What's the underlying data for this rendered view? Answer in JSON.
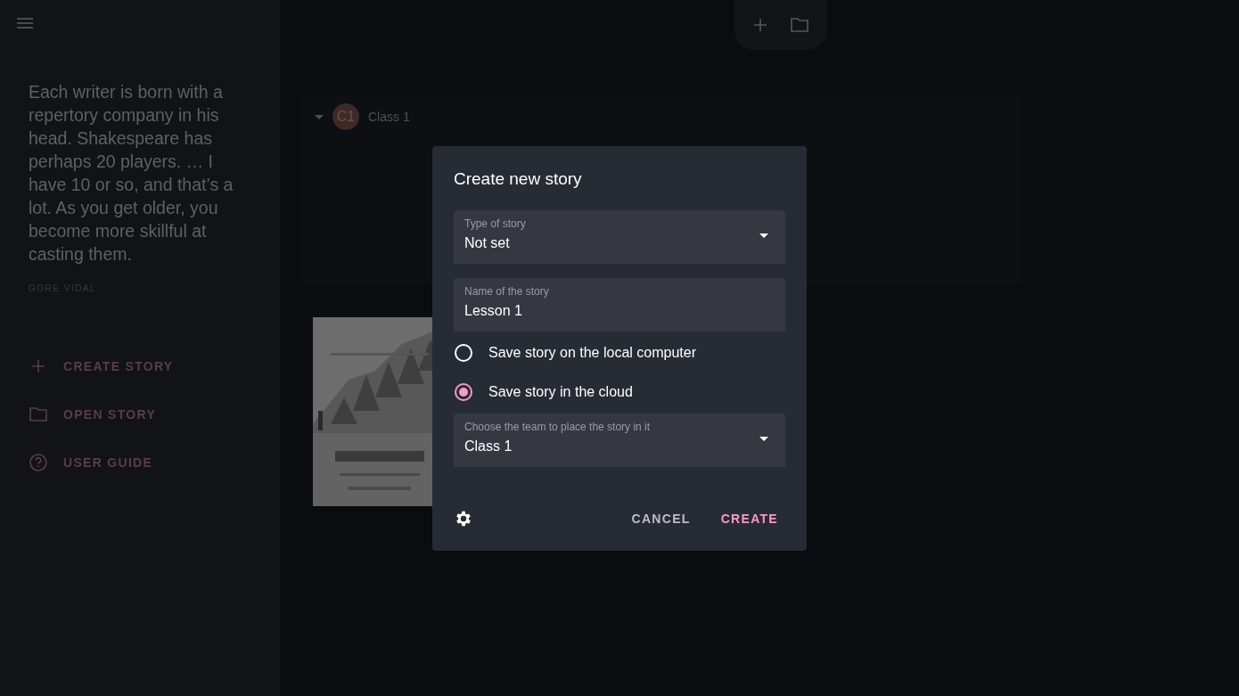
{
  "sidebar": {
    "quote": "Each writer is born with a repertory company in his head. Shakespeare has perhaps 20 players. … I have 10 or so, and that’s a lot. As you get older, you become more skillful at casting them.",
    "author": "GORE VIDAL",
    "items": [
      {
        "kind": "create",
        "label": "CREATE STORY"
      },
      {
        "kind": "open",
        "label": "OPEN STORY"
      },
      {
        "kind": "guide",
        "label": "USER GUIDE"
      }
    ]
  },
  "team": {
    "avatar": "C1",
    "name": "Class 1",
    "expanded": true
  },
  "dialog": {
    "title": "Create new story",
    "controls": [
      {
        "kind": "select",
        "label": "Type of story",
        "value": "Not set"
      },
      {
        "kind": "input",
        "label": "Name of the story",
        "value": "Lesson 1"
      },
      {
        "kind": "radio",
        "label": "Save story on the local computer",
        "selected": false
      },
      {
        "kind": "radio",
        "label": "Save story in the cloud",
        "selected": true
      },
      {
        "kind": "select",
        "label": "Choose the team to place the story in it",
        "value": "Class 1"
      }
    ],
    "buttons": [
      {
        "label": "CANCEL",
        "primary": false
      },
      {
        "label": "CREATE",
        "primary": true
      }
    ]
  }
}
